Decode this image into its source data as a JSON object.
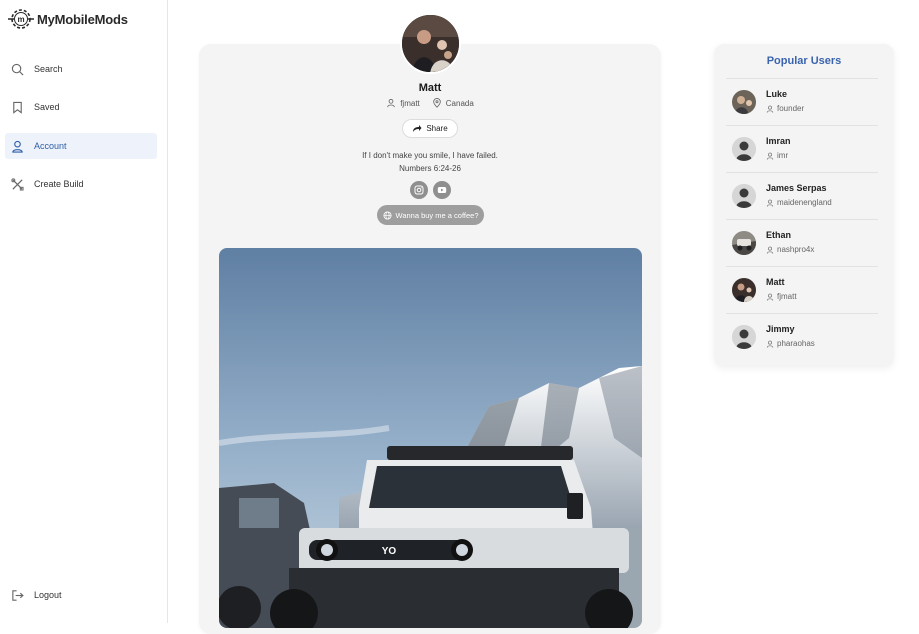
{
  "brand": {
    "name": "MyMobileMods",
    "logo_letter": "m"
  },
  "sidebar": {
    "items": [
      {
        "label": "Search",
        "icon": "search-icon"
      },
      {
        "label": "Saved",
        "icon": "bookmark-icon"
      },
      {
        "label": "Account",
        "icon": "user-icon",
        "active": true
      },
      {
        "label": "Create Build",
        "icon": "tools-icon"
      }
    ],
    "logout_label": "Logout"
  },
  "profile": {
    "name": "Matt",
    "username": "fjmatt",
    "location": "Canada",
    "share_label": "Share",
    "bio_line1": "If I don't make you smile, I have failed.",
    "bio_line2": "Numbers 6:24-26",
    "socials": [
      "instagram-icon",
      "youtube-icon"
    ],
    "coffee_label": "Wanna buy me a coffee?",
    "photo_plate": "YO"
  },
  "popular_users": {
    "title": "Popular Users",
    "users": [
      {
        "name": "Luke",
        "handle": "founder"
      },
      {
        "name": "Imran",
        "handle": "imr"
      },
      {
        "name": "James Serpas",
        "handle": "maidenengland"
      },
      {
        "name": "Ethan",
        "handle": "nashpro4x"
      },
      {
        "name": "Matt",
        "handle": "fjmatt"
      },
      {
        "name": "Jimmy",
        "handle": "pharaohas"
      }
    ]
  },
  "colors": {
    "accent": "#3a64ad",
    "active_bg": "#edf2fb",
    "card_bg": "#f4f4f5"
  }
}
